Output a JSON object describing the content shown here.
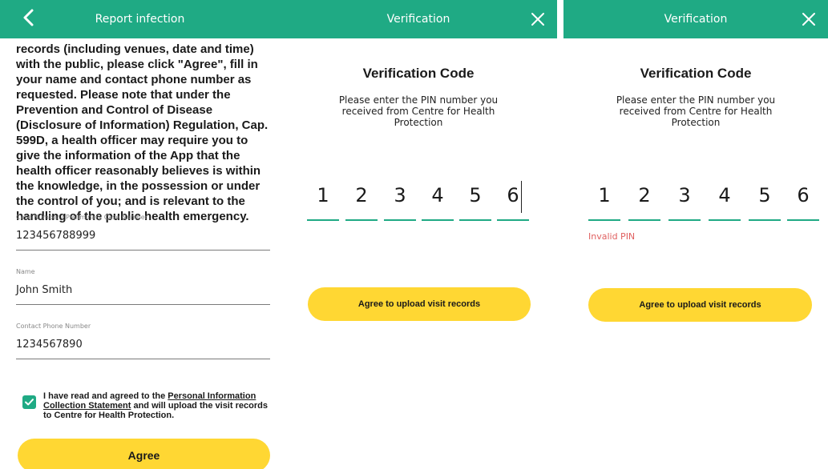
{
  "report_screen": {
    "title": "Report infection",
    "consent_text": "records (including venues, date and time) with the public, please click \"Agree\", fill in your name and contact phone number as requested. Please note that under the Prevention and Control of Disease (Disclosure of Information) Regulation, Cap. 599D, a health officer may require you to give the information of the App that the health officer reasonably believes is within the knowledge, in the possession or under the control of you; and is relevant to the handling of the public health emergency.",
    "fields": [
      {
        "label": "Case Number / Preliminary Case Number",
        "value": "123456788999"
      },
      {
        "label": "Name",
        "value": "John Smith"
      },
      {
        "label": "Contact Phone Number",
        "value": "1234567890"
      }
    ],
    "checkbox": {
      "checked": true,
      "text_before": "I have read and agreed to the ",
      "link_text": "Personal Information Collection Statement",
      "text_after": " and will upload the visit records to Centre for Health Protection."
    },
    "agree_label": "Agree"
  },
  "verification_screen": {
    "title": "Verification",
    "heading": "Verification Code",
    "description": "Please enter the PIN number you received from Centre for Health Protection",
    "pin_digits": [
      "1",
      "2",
      "3",
      "4",
      "5",
      "6"
    ],
    "upload_label": "Agree to upload visit records"
  },
  "verification_error_screen": {
    "title": "Verification",
    "heading": "Verification Code",
    "description": "Please enter the PIN number you received from Centre for Health Protection",
    "pin_digits": [
      "1",
      "2",
      "3",
      "4",
      "5",
      "6"
    ],
    "error": "Invalid PIN",
    "upload_label": "Agree to upload visit records"
  },
  "colors": {
    "brand_green": "#1faa84",
    "button_yellow": "#ffd733",
    "error_red": "#e06060"
  },
  "icons": {
    "back": "chevron-left-icon",
    "close": "close-icon",
    "checkbox": "checkmark-icon"
  }
}
